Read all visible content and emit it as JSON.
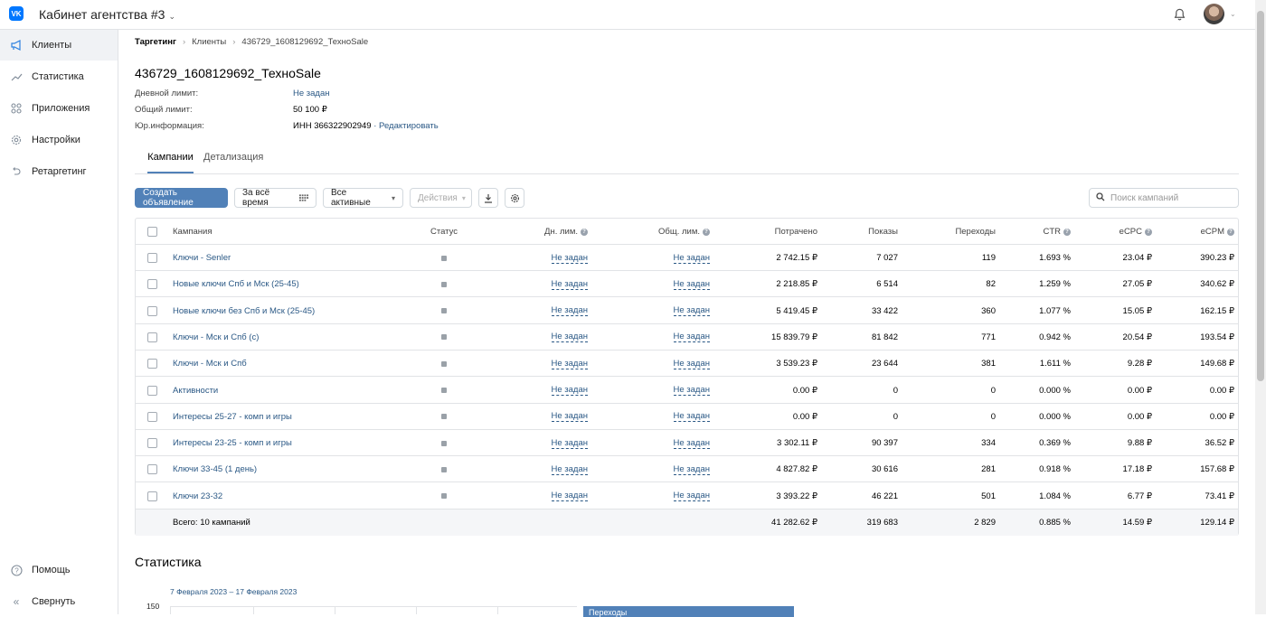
{
  "header": {
    "logo": "VK",
    "agency": "Кабинет агентства #3"
  },
  "sidebar": {
    "items": [
      {
        "label": "Клиенты",
        "icon": "megaphone-icon"
      },
      {
        "label": "Статистика",
        "icon": "chart-icon"
      },
      {
        "label": "Приложения",
        "icon": "apps-icon"
      },
      {
        "label": "Настройки",
        "icon": "gear-icon"
      },
      {
        "label": "Ретаргетинг",
        "icon": "retarget-icon"
      }
    ],
    "help": "Помощь",
    "collapse": "Свернуть"
  },
  "breadcrumbs": [
    "Таргетинг",
    "Клиенты",
    "436729_1608129692_ТехноSale"
  ],
  "client": {
    "title": "436729_1608129692_ТехноSale",
    "daily_label": "Дневной лимит:",
    "daily_value": "Не задан",
    "total_label": "Общий лимит:",
    "total_value": "50 100 ₽",
    "legal_label": "Юр.информация:",
    "legal_value": "ИНН 366322902949",
    "edit": "· Редактировать"
  },
  "tabs": [
    "Кампании",
    "Детализация"
  ],
  "toolbar": {
    "create": "Создать объявление",
    "period": "За всё время",
    "filter": "Все активные",
    "actions": "Действия",
    "search_placeholder": "Поиск кампаний"
  },
  "table": {
    "columns": [
      "Кампания",
      "Статус",
      "Дн. лим.",
      "Общ. лим.",
      "Потрачено",
      "Показы",
      "Переходы",
      "CTR",
      "eCPC",
      "eCPM"
    ],
    "rows": [
      {
        "name": "Ключи - Senler",
        "daily": "Не задан",
        "total": "Не задан",
        "spent": "2 742.15 ₽",
        "impressions": "7 027",
        "clicks": "119",
        "ctr": "1.693 %",
        "ecpc": "23.04 ₽",
        "ecpm": "390.23 ₽"
      },
      {
        "name": "Новые ключи Спб и Мск (25-45)",
        "daily": "Не задан",
        "total": "Не задан",
        "spent": "2 218.85 ₽",
        "impressions": "6 514",
        "clicks": "82",
        "ctr": "1.259 %",
        "ecpc": "27.05 ₽",
        "ecpm": "340.62 ₽"
      },
      {
        "name": "Новые ключи без Спб и Мск (25-45)",
        "daily": "Не задан",
        "total": "Не задан",
        "spent": "5 419.45 ₽",
        "impressions": "33 422",
        "clicks": "360",
        "ctr": "1.077 %",
        "ecpc": "15.05 ₽",
        "ecpm": "162.15 ₽"
      },
      {
        "name": "Ключи - Мск и Спб (с)",
        "daily": "Не задан",
        "total": "Не задан",
        "spent": "15 839.79 ₽",
        "impressions": "81 842",
        "clicks": "771",
        "ctr": "0.942 %",
        "ecpc": "20.54 ₽",
        "ecpm": "193.54 ₽"
      },
      {
        "name": "Ключи - Мск и Спб",
        "daily": "Не задан",
        "total": "Не задан",
        "spent": "3 539.23 ₽",
        "impressions": "23 644",
        "clicks": "381",
        "ctr": "1.611 %",
        "ecpc": "9.28 ₽",
        "ecpm": "149.68 ₽"
      },
      {
        "name": "Активности",
        "daily": "Не задан",
        "total": "Не задан",
        "spent": "0.00 ₽",
        "impressions": "0",
        "clicks": "0",
        "ctr": "0.000 %",
        "ecpc": "0.00 ₽",
        "ecpm": "0.00 ₽"
      },
      {
        "name": "Интересы 25-27 - комп и игры",
        "daily": "Не задан",
        "total": "Не задан",
        "spent": "0.00 ₽",
        "impressions": "0",
        "clicks": "0",
        "ctr": "0.000 %",
        "ecpc": "0.00 ₽",
        "ecpm": "0.00 ₽"
      },
      {
        "name": "Интересы 23-25 - комп и игры",
        "daily": "Не задан",
        "total": "Не задан",
        "spent": "3 302.11 ₽",
        "impressions": "90 397",
        "clicks": "334",
        "ctr": "0.369 %",
        "ecpc": "9.88 ₽",
        "ecpm": "36.52 ₽"
      },
      {
        "name": "Ключи 33-45 (1 день)",
        "daily": "Не задан",
        "total": "Не задан",
        "spent": "4 827.82 ₽",
        "impressions": "30 616",
        "clicks": "281",
        "ctr": "0.918 %",
        "ecpc": "17.18 ₽",
        "ecpm": "157.68 ₽"
      },
      {
        "name": "Ключи 23-32",
        "daily": "Не задан",
        "total": "Не задан",
        "spent": "3 393.22 ₽",
        "impressions": "46 221",
        "clicks": "501",
        "ctr": "1.084 %",
        "ecpc": "6.77 ₽",
        "ecpm": "73.41 ₽"
      }
    ],
    "total": {
      "label": "Всего: 10 кампаний",
      "spent": "41 282.62 ₽",
      "impressions": "319 683",
      "clicks": "2 829",
      "ctr": "0.885 %",
      "ecpc": "14.59 ₽",
      "ecpm": "129.14 ₽"
    }
  },
  "stats": {
    "title": "Статистика",
    "date_range": "7 Февраля 2023 – 17 Февраля 2023",
    "y_tick": "150",
    "tooltip": "Переходы"
  },
  "colors": {
    "accent": "#5181b8",
    "link": "#2a5885"
  }
}
